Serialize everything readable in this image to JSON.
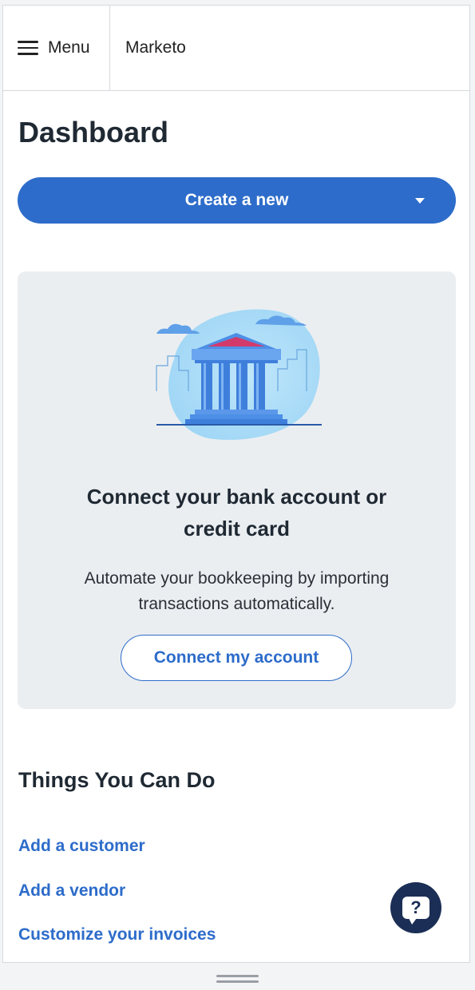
{
  "header": {
    "menu_label": "Menu",
    "brand": "Marketo"
  },
  "dashboard": {
    "title": "Dashboard",
    "create_button_label": "Create a new"
  },
  "bank_card": {
    "title_line1": "Connect your bank account or",
    "title_line2": "credit card",
    "desc_line1": "Automate your bookkeeping by importing",
    "desc_line2": "transactions automatically.",
    "button_label": "Connect my account"
  },
  "things": {
    "title": "Things You Can Do",
    "links": [
      "Add a customer",
      "Add a vendor",
      "Customize your invoices"
    ]
  },
  "help": {
    "glyph": "?"
  },
  "colors": {
    "accent": "#2d6cca",
    "card_bg": "#ebeef1",
    "help_bg": "#1b2e55",
    "bank_roof": "#d23a6b"
  },
  "icons": [
    "hamburger-menu-icon",
    "caret-down-icon",
    "bank-illustration",
    "help-chat-icon"
  ]
}
